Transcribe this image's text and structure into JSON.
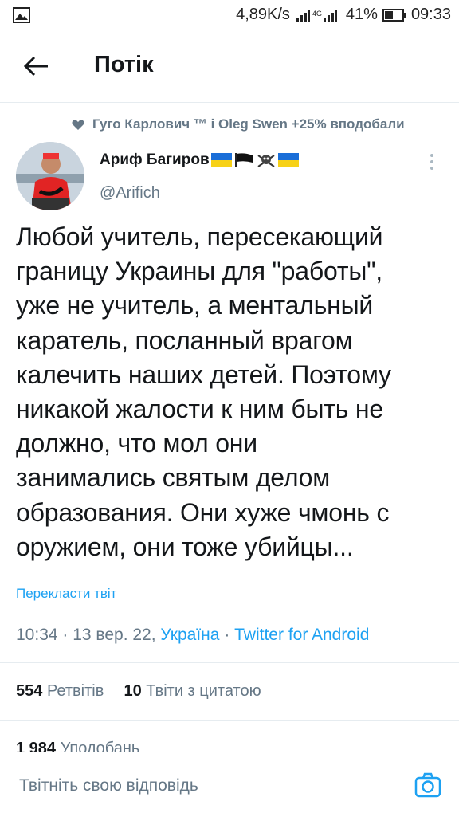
{
  "status_bar": {
    "speed": "4,89K/s",
    "network": "4G",
    "battery": "41%",
    "time": "09:33"
  },
  "header": {
    "title": "Потік"
  },
  "social_context": {
    "text": "Гуго Карлович ™ і Oleg Swen +25% вподобали"
  },
  "author": {
    "name": "Ариф Багиров",
    "handle": "@Arifich"
  },
  "tweet": {
    "lines": [
      "Любой учитель, пересекающий",
      "границу Украины для \"работы\",",
      "уже не учитель, а ментальный",
      "каратель, посланный врагом",
      "калечить наших детей. Поэтому",
      "никакой жалости к ним быть не",
      "должно, что мол они",
      "занимались святым делом",
      "образования. Они хуже чмонь с",
      "оружием, они тоже убийцы..."
    ],
    "translate_label": "Перекласти твіт",
    "time": "10:34",
    "date": "13 вер. 22",
    "location": "Україна",
    "source": "Twitter for Android"
  },
  "stats": {
    "retweets_count": "554",
    "retweets_label": "Ретвітів",
    "quotes_count": "10",
    "quotes_label": "Твіти з цитатою",
    "likes_count": "1 984",
    "likes_label": "Уподобань"
  },
  "reply": {
    "placeholder": "Твітніть свою відповідь"
  },
  "colors": {
    "accent": "#1da1f2",
    "muted": "#657786",
    "text": "#14171a"
  },
  "icons": [
    "image-icon",
    "signal-icon",
    "battery-icon",
    "back-arrow-icon",
    "heart-icon",
    "more-vertical-icon",
    "camera-icon"
  ]
}
